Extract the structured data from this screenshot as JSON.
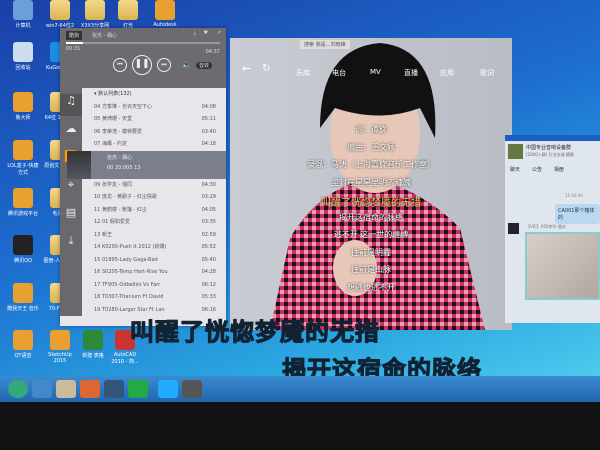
{
  "desktop": {
    "icons": [
      {
        "label": "计算机",
        "kind": "computer"
      },
      {
        "label": "win7-64位2",
        "kind": "folder"
      },
      {
        "label": "X3X3分享网",
        "kind": "folder"
      },
      {
        "label": "灯光",
        "kind": "folder"
      },
      {
        "label": "Autodesk",
        "kind": "app"
      },
      {
        "label": "回收站",
        "kind": "recycle"
      },
      {
        "label": "KuGou 酷狗",
        "kind": "kugou"
      },
      {
        "label": "鲁大师",
        "kind": "app"
      },
      {
        "label": "64位 1550系",
        "kind": "folder"
      },
      {
        "label": "LOL盒子-快捷方式",
        "kind": "app"
      },
      {
        "label": "原创文 快捷方",
        "kind": "folder"
      },
      {
        "label": "腾讯游戏平台",
        "kind": "app"
      },
      {
        "label": "毛泽中",
        "kind": "folder"
      },
      {
        "label": "腾讯QQ",
        "kind": "qq"
      },
      {
        "label": "图册-人 WXS3",
        "kind": "folder"
      },
      {
        "label": "酷我天王 音乐",
        "kind": "app"
      },
      {
        "label": "70-F 日常",
        "kind": "folder"
      },
      {
        "label": "QT语音",
        "kind": "app"
      },
      {
        "label": "SketchUp 2015",
        "kind": "app"
      },
      {
        "label": "新建 表格",
        "kind": "excel"
      },
      {
        "label": "AutoCAD 2010 - 简...",
        "kind": "autocad"
      }
    ]
  },
  "mini_player": {
    "tab": "酷狗",
    "now_playing": "张杰 - 偶心",
    "time_elapsed": "00:31",
    "time_total": "04:37",
    "volume_label": "音效",
    "playlist_title": "默认列表",
    "playlist_count": "(132)",
    "tracks": [
      {
        "num": "04",
        "title": "方季惟 - 也许天空下心",
        "dur": "04:08"
      },
      {
        "num": "05",
        "title": "黄绮珊 - 天堂",
        "dur": "05:11"
      },
      {
        "num": "06",
        "title": "李荣浩 - 模特要爱",
        "dur": "03:40"
      },
      {
        "num": "07",
        "title": "海鹰 - 约定",
        "dur": "04:18"
      },
      {
        "num": "09",
        "title": "张学友 - 偎同",
        "dur": "04:30"
      },
      {
        "num": "10",
        "title": "庞龙 - 黄鹂子 - 红尘情歌",
        "dur": "03:29"
      },
      {
        "num": "11",
        "title": "黄鹤楼 - 帐篷 - 红尘",
        "dur": "04:05"
      },
      {
        "num": "12",
        "title": "01 假如爱爱",
        "dur": "03:35"
      },
      {
        "num": "13",
        "title": "新王",
        "dur": "02:59"
      },
      {
        "num": "14",
        "title": "K0200-Push It 2012 (劲爆)",
        "dur": "05:52"
      },
      {
        "num": "15",
        "title": "01895-Lady Gaga-Bad",
        "dur": "05:40"
      },
      {
        "num": "16",
        "title": "S0205-Temp Hart-Rise You",
        "dur": "04:28"
      },
      {
        "num": "17",
        "title": "TF905-Odbellini Vs Farr",
        "dur": "06:12"
      },
      {
        "num": "18",
        "title": "T0307-Titanium Ft David",
        "dur": "05:33"
      },
      {
        "num": "19",
        "title": "T0280-Larger Star Ft Lan",
        "dur": "06:16"
      }
    ],
    "current": {
      "title": "张杰 - 偶心",
      "sub": "00 20:005 13"
    }
  },
  "main_window": {
    "title": "搜索 我是…刘晓峰",
    "nav": [
      "乐库",
      "电台",
      "MV",
      "直播",
      "应用",
      "歌词"
    ],
    "lyrics": [
      "词：谭旋",
      "编曲：王文颖",
      "录混：马涛（上海嘉旋音乐工作室）",
      "尘封在星星里明的魂魄",
      "叫醒了恍惚梦魇的无措",
      "揭开这宿命的脉络",
      "逃不开 这一世的缠缚",
      "往前是阴霾",
      "往前是山脉",
      "想逃也逃不开"
    ],
    "current_lyric_index": 4,
    "highlight_color": "#f0c060"
  },
  "chat": {
    "group": "中国专业音响设备群",
    "meta": "(2000人群) 行业交流 随缘",
    "tabs": [
      "聊天",
      "公告",
      "相册"
    ],
    "time": "11:03:40",
    "message": "CA001那个箱体的",
    "sender": "【VIC】A00李华-重庆"
  },
  "desktop_lyrics": [
    "叫醒了恍惚梦魇的无措",
    "揭开这宿命的脉络"
  ],
  "taskbar": {
    "items": [
      "start",
      "ie",
      "explorer",
      "media",
      "word",
      "sogou-5",
      "kugou",
      "app"
    ]
  }
}
